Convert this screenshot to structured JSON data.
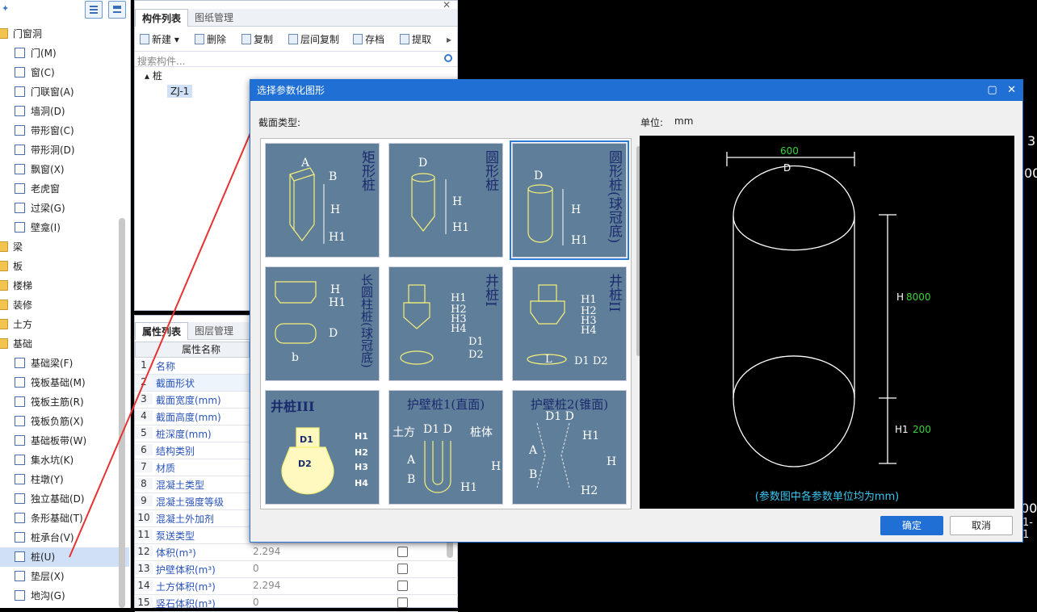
{
  "tree": {
    "groups": [
      {
        "label": "门窗洞"
      },
      {
        "label": "梁"
      },
      {
        "label": "板"
      },
      {
        "label": "楼梯"
      },
      {
        "label": "装修"
      },
      {
        "label": "土方"
      },
      {
        "label": "基础"
      }
    ],
    "door_items": [
      "门(M)",
      "窗(C)",
      "门联窗(A)",
      "墙洞(D)",
      "带形窗(C)",
      "带形洞(D)",
      "飘窗(X)",
      "老虎窗",
      "过梁(G)",
      "壁龛(I)"
    ],
    "found_items": [
      "基础梁(F)",
      "筏板基础(M)",
      "筏板主筋(R)",
      "筏板负筋(X)",
      "基础板带(W)",
      "集水坑(K)",
      "柱墩(Y)",
      "独立基础(D)",
      "条形基础(T)",
      "桩承台(V)",
      "桩(U)",
      "垫层(X)",
      "地沟(G)"
    ]
  },
  "component_panel": {
    "tabs": [
      "构件列表",
      "图纸管理"
    ],
    "toolbar": [
      "新建",
      "删除",
      "复制",
      "层间复制",
      "存档",
      "提取"
    ],
    "search_placeholder": "搜索构件...",
    "tree_root": "桩",
    "tree_item": "ZJ-1"
  },
  "property_panel": {
    "tabs": [
      "属性列表",
      "图层管理"
    ],
    "header": "属性名称",
    "rows": [
      {
        "n": "1",
        "k": "名称",
        "v": ""
      },
      {
        "n": "2",
        "k": "截面形状",
        "v": ""
      },
      {
        "n": "3",
        "k": "截面宽度(mm)",
        "v": ""
      },
      {
        "n": "4",
        "k": "截面高度(mm)",
        "v": ""
      },
      {
        "n": "5",
        "k": "桩深度(mm)",
        "v": ""
      },
      {
        "n": "6",
        "k": "结构类别",
        "v": ""
      },
      {
        "n": "7",
        "k": "材质",
        "v": ""
      },
      {
        "n": "8",
        "k": "混凝土类型",
        "v": ""
      },
      {
        "n": "9",
        "k": "混凝土强度等级",
        "v": ""
      },
      {
        "n": "10",
        "k": "混凝土外加剂",
        "v": ""
      },
      {
        "n": "11",
        "k": "泵送类型",
        "v": ""
      },
      {
        "n": "12",
        "k": "体积(m³)",
        "v": "2.294"
      },
      {
        "n": "13",
        "k": "护壁体积(m³)",
        "v": "0"
      },
      {
        "n": "14",
        "k": "土方体积(m³)",
        "v": "2.294"
      },
      {
        "n": "15",
        "k": "竖石体积(m³)",
        "v": "0"
      }
    ]
  },
  "dialog": {
    "title": "选择参数化图形",
    "section_label": "截面类型:",
    "unit_label": "单位:",
    "unit_value": "mm",
    "shapes": [
      {
        "title": "矩形桩"
      },
      {
        "title": "圆形桩"
      },
      {
        "title": "圆形桩(球冠底)"
      },
      {
        "title": "长圆柱桩(球冠底)"
      },
      {
        "title": "井桩I"
      },
      {
        "title": "井桩II"
      },
      {
        "title": "井桩III"
      },
      {
        "title": "护壁桩1(直面)"
      },
      {
        "title": "护壁桩2(锥面)"
      }
    ],
    "preview": {
      "D_value": "600",
      "D_label": "D",
      "H_label": "H",
      "H_value": "8000",
      "H1_label": "H1",
      "H1_value": "200",
      "note": "(参数图中各参数单位均为mm)"
    },
    "ok": "确定",
    "cancel": "取消"
  },
  "colors": {
    "accent": "#1f6fd4",
    "cad_green": "#3cd23c",
    "cad_cyan": "#39c6f0"
  }
}
